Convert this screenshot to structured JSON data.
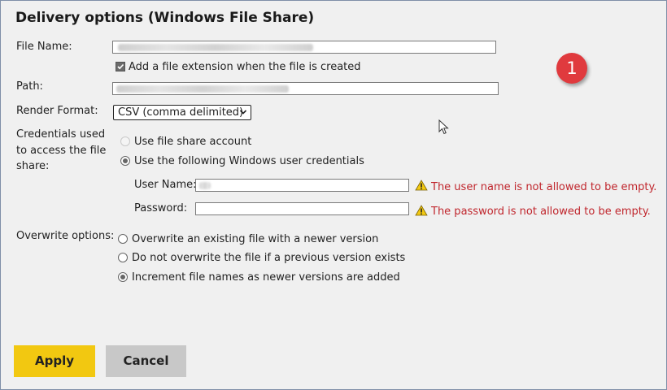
{
  "dialog": {
    "title": "Delivery options (Windows File Share)",
    "file_name_label": "File Name:",
    "add_extension_label": "Add a file extension when the file is created",
    "add_extension_checked": true,
    "path_label": "Path:",
    "render_format_label": "Render Format:",
    "render_format_value": "CSV (comma delimited)",
    "credentials_label_line1": "Credentials used",
    "credentials_label_line2": "to access the file",
    "credentials_label_line3": "share:",
    "cred_option_share": "Use file share account",
    "cred_option_windows": "Use the following Windows user credentials",
    "user_name_label": "User Name:",
    "user_name_error": "The user name is not allowed to be empty.",
    "password_label": "Password:",
    "password_error": "The password is not allowed to be empty.",
    "overwrite_label": "Overwrite options:",
    "overwrite_opt1": "Overwrite an existing file with a newer version",
    "overwrite_opt2": "Do not overwrite the file if a previous version exists",
    "overwrite_opt3": "Increment file names as newer versions are added"
  },
  "badge": {
    "number": "1"
  },
  "buttons": {
    "apply": "Apply",
    "cancel": "Cancel"
  },
  "colors": {
    "apply_bg": "#f2c811",
    "error": "#c0262d",
    "badge": "#e03a3e"
  },
  "icons": [
    "warning-icon",
    "chevron-down-icon",
    "checkmark-icon",
    "mouse-cursor-icon"
  ]
}
